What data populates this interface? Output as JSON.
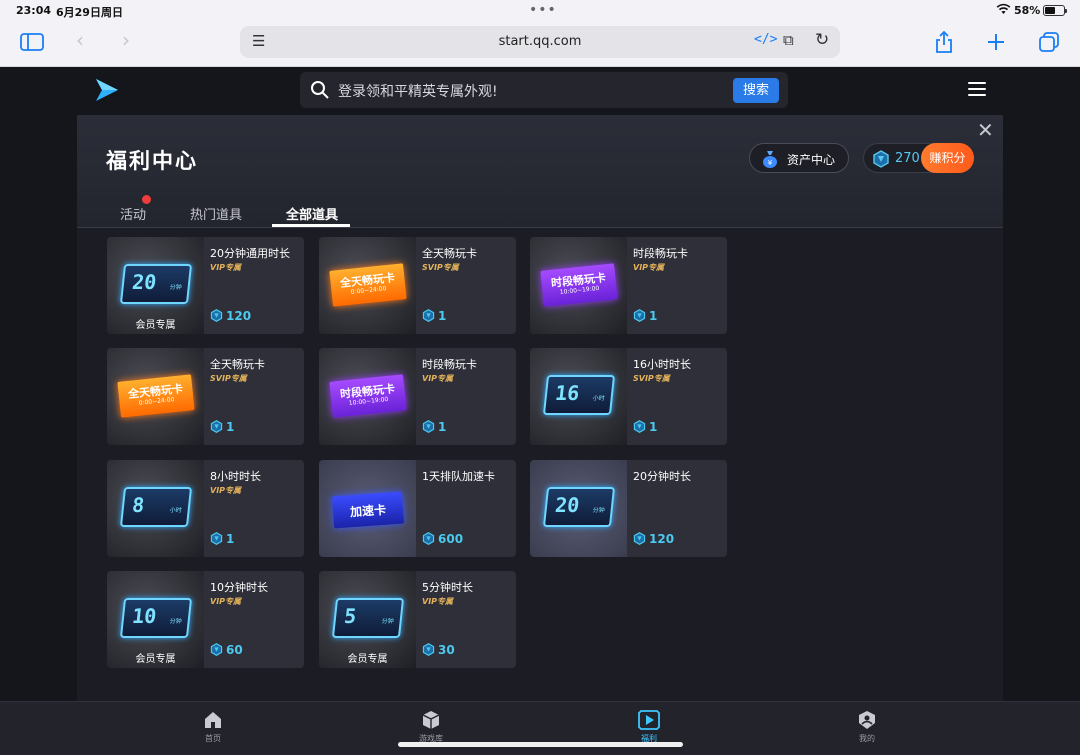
{
  "status_bar": {
    "time": "23:04",
    "date": "6月29日周日",
    "battery": "58%",
    "battery_level": 0.58
  },
  "browser": {
    "url": "start.qq.com"
  },
  "site_header": {
    "search_placeholder": "登录领和平精英专属外观!",
    "search_button": "搜索"
  },
  "panel": {
    "title": "福利中心",
    "asset_center": "资产中心",
    "points": "270",
    "earn_points": "赚积分",
    "tabs": [
      "活动",
      "热门道具",
      "全部道具"
    ],
    "active_tab": "全部道具"
  },
  "items": [
    {
      "name": "20分钟通用时长",
      "tag": "VIP专属",
      "price": "120",
      "member": "会员专属",
      "thumb": "time",
      "thumb_value": "20",
      "thumb_unit": "分钟"
    },
    {
      "name": "全天畅玩卡",
      "tag": "SVIP专属",
      "price": "1",
      "thumb": "orange",
      "thumb_title": "全天畅玩卡",
      "thumb_sub": "0:00~24:00"
    },
    {
      "name": "时段畅玩卡",
      "tag": "VIP专属",
      "price": "1",
      "thumb": "purple",
      "thumb_title": "时段畅玩卡",
      "thumb_sub": "10:00~19:00"
    },
    {
      "name": "全天畅玩卡",
      "tag": "SVIP专属",
      "price": "1",
      "thumb": "orange",
      "thumb_title": "全天畅玩卡",
      "thumb_sub": "0:00~24:00"
    },
    {
      "name": "时段畅玩卡",
      "tag": "VIP专属",
      "price": "1",
      "thumb": "purple",
      "thumb_title": "时段畅玩卡",
      "thumb_sub": "10:00~19:00"
    },
    {
      "name": "16小时时长",
      "tag": "SVIP专属",
      "price": "1",
      "thumb": "time",
      "thumb_value": "16",
      "thumb_unit": "小时"
    },
    {
      "name": "8小时时长",
      "tag": "VIP专属",
      "price": "1",
      "thumb": "time",
      "thumb_value": "8",
      "thumb_unit": "小时"
    },
    {
      "name": "1天排队加速卡",
      "tag": "",
      "price": "600",
      "thumb": "speed",
      "thumb_title": "加速卡"
    },
    {
      "name": "20分钟时长",
      "tag": "",
      "price": "120",
      "thumb": "time",
      "thumb_value": "20",
      "thumb_unit": "分钟"
    },
    {
      "name": "10分钟时长",
      "tag": "VIP专属",
      "price": "60",
      "member": "会员专属",
      "thumb": "time",
      "thumb_value": "10",
      "thumb_unit": "分钟"
    },
    {
      "name": "5分钟时长",
      "tag": "VIP专属",
      "price": "30",
      "member": "会员专属",
      "thumb": "time",
      "thumb_value": "5",
      "thumb_unit": "分钟"
    }
  ],
  "bottom_nav": [
    {
      "label": "首页",
      "icon": "home-icon"
    },
    {
      "label": "游戏库",
      "icon": "box-icon"
    },
    {
      "label": "福利",
      "icon": "play-icon",
      "active": true
    },
    {
      "label": "我的",
      "icon": "profile-icon"
    }
  ],
  "colors": {
    "accent": "#2a7ae8",
    "points": "#4cc9ee",
    "earn": "#ff6a1a",
    "vip_tag": "#e3b25a"
  }
}
